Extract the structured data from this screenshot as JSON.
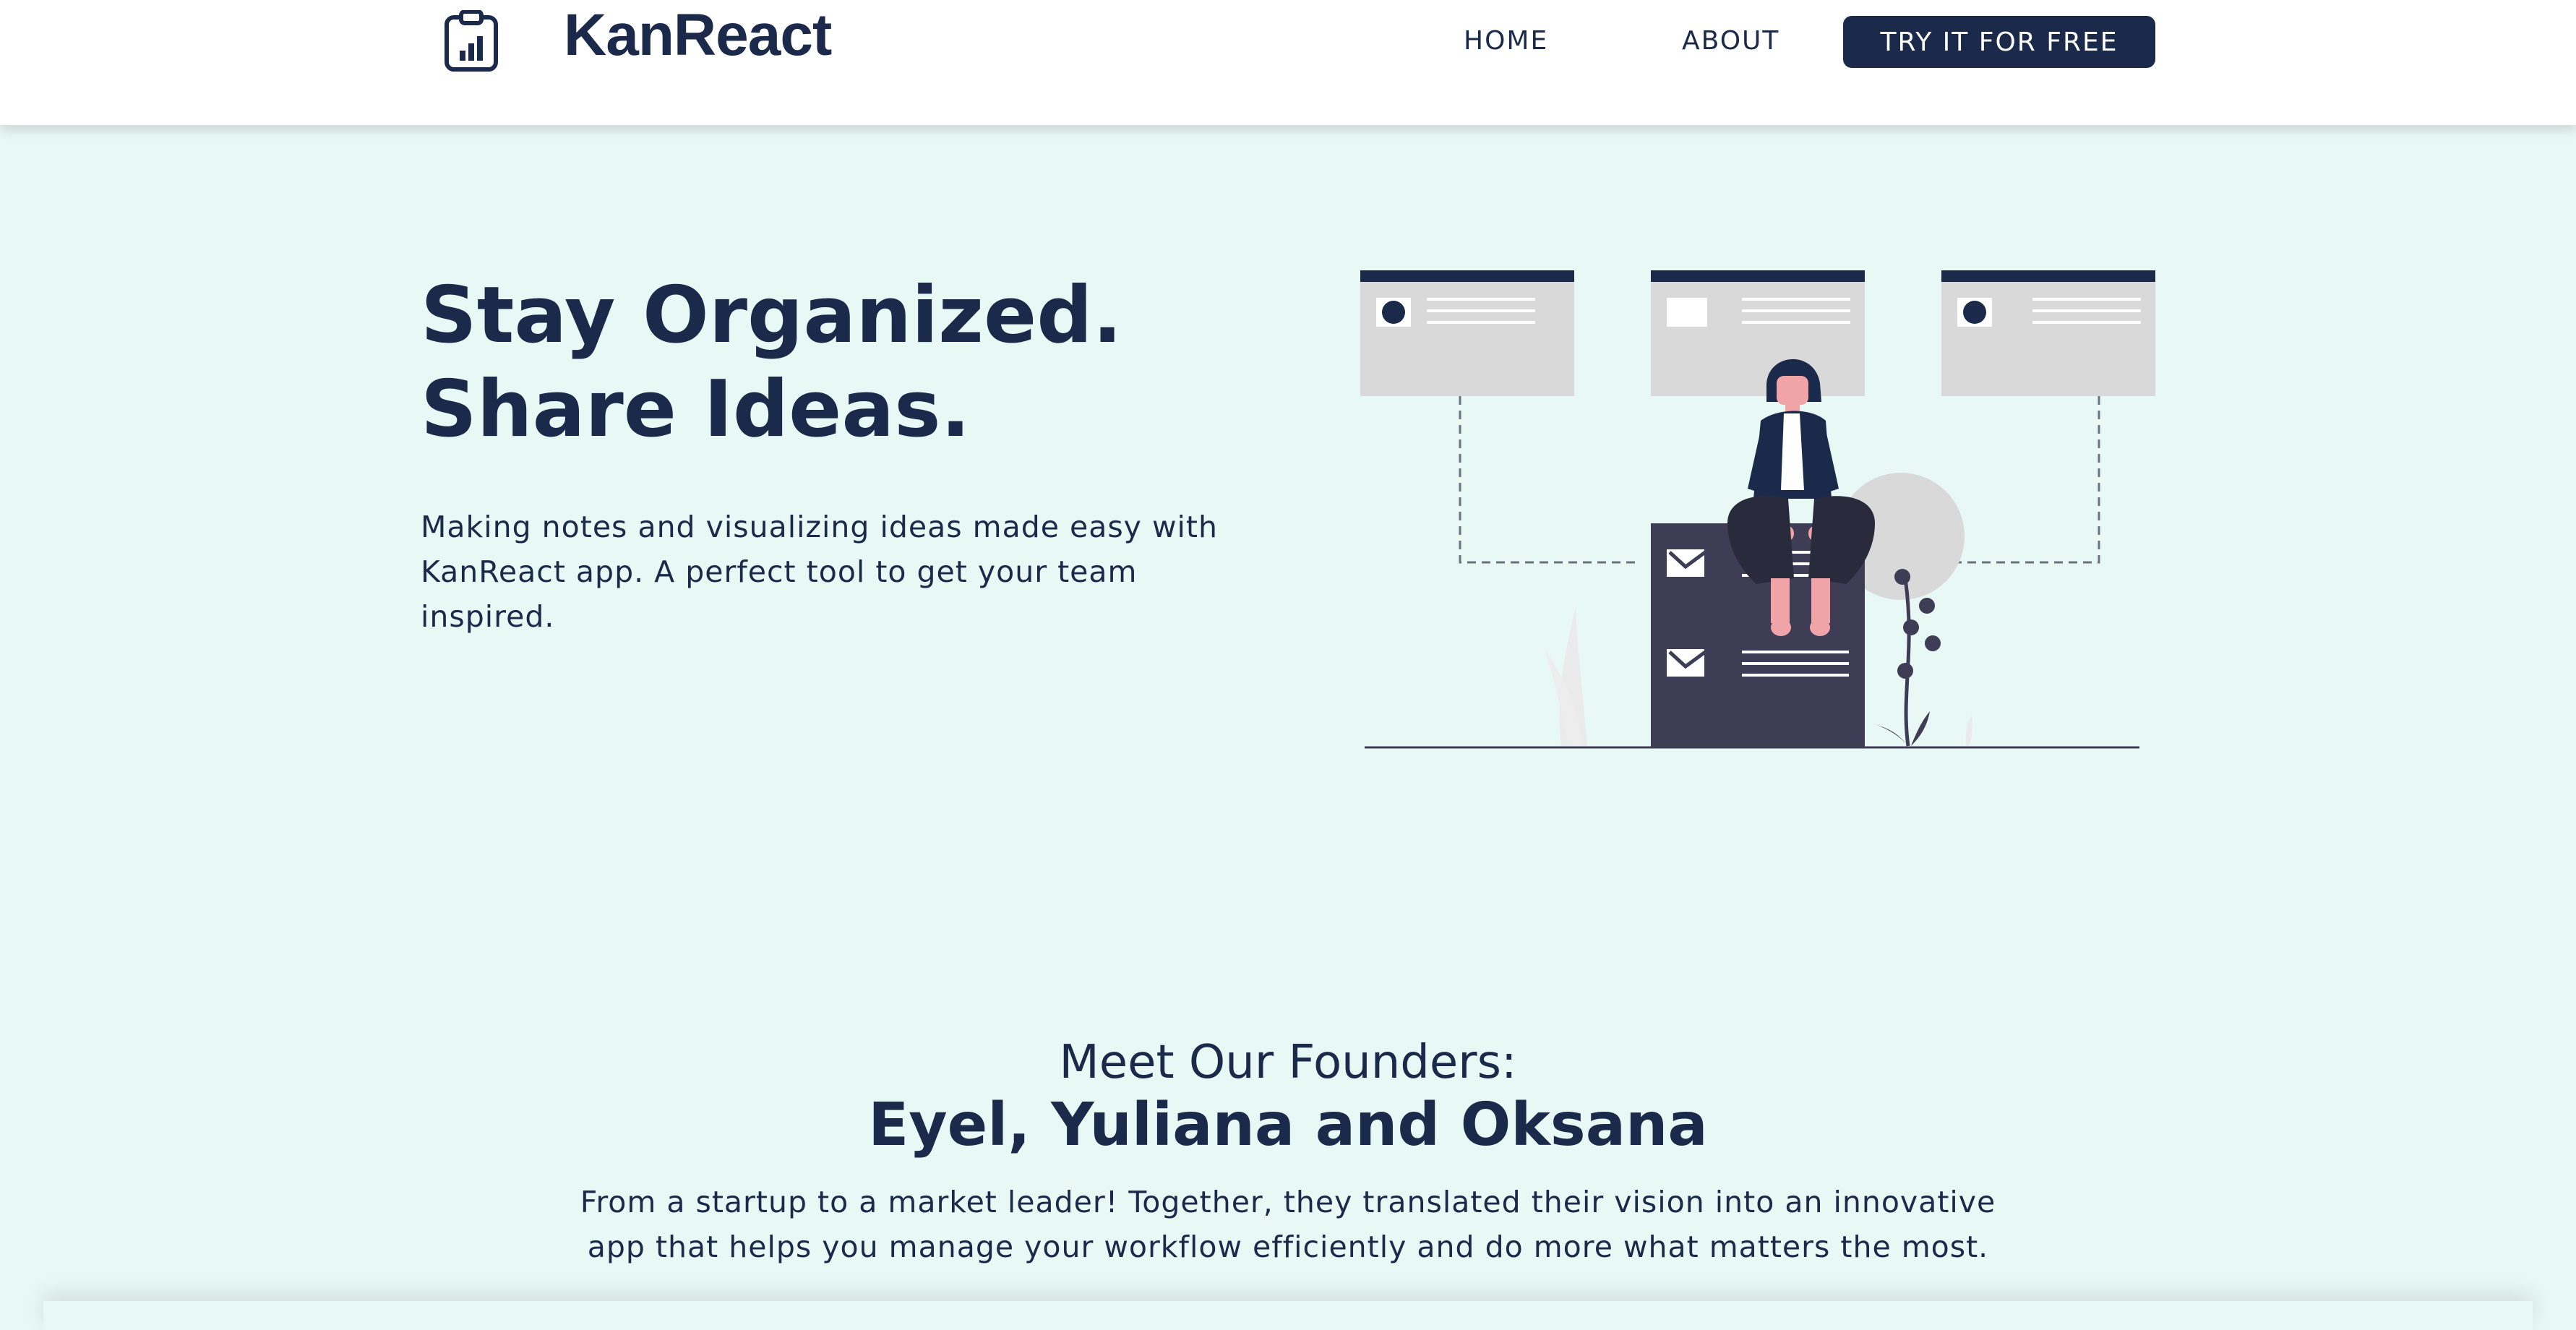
{
  "header": {
    "brand": "KanReact",
    "logo_icon": "clipboard-chart-icon",
    "nav": {
      "home": "HOME",
      "about": "ABOUT"
    },
    "cta_label": "TRY IT FOR FREE"
  },
  "hero": {
    "title_line1": "Stay Organized.",
    "title_line2": "Share Ideas.",
    "description": "Making notes and visualizing ideas made easy with KanReact app. A perfect tool to get your team inspired.",
    "illustration": "woman-sitting-on-task-board-illustration"
  },
  "founders": {
    "heading": "Meet Our Founders:",
    "names": "Eyel, Yuliana and Oksana",
    "description": "From a startup to a market leader! Together, they translated their vision into an innovative app that helps you manage your workflow efficiently and do more what matters the most."
  },
  "colors": {
    "background": "#e8f8f4",
    "primary": "#1b2a4a",
    "header_bg": "#ffffff",
    "card_gray": "#d9d9d9",
    "board_dark": "#3f3d56",
    "skin": "#f0a4a8"
  }
}
